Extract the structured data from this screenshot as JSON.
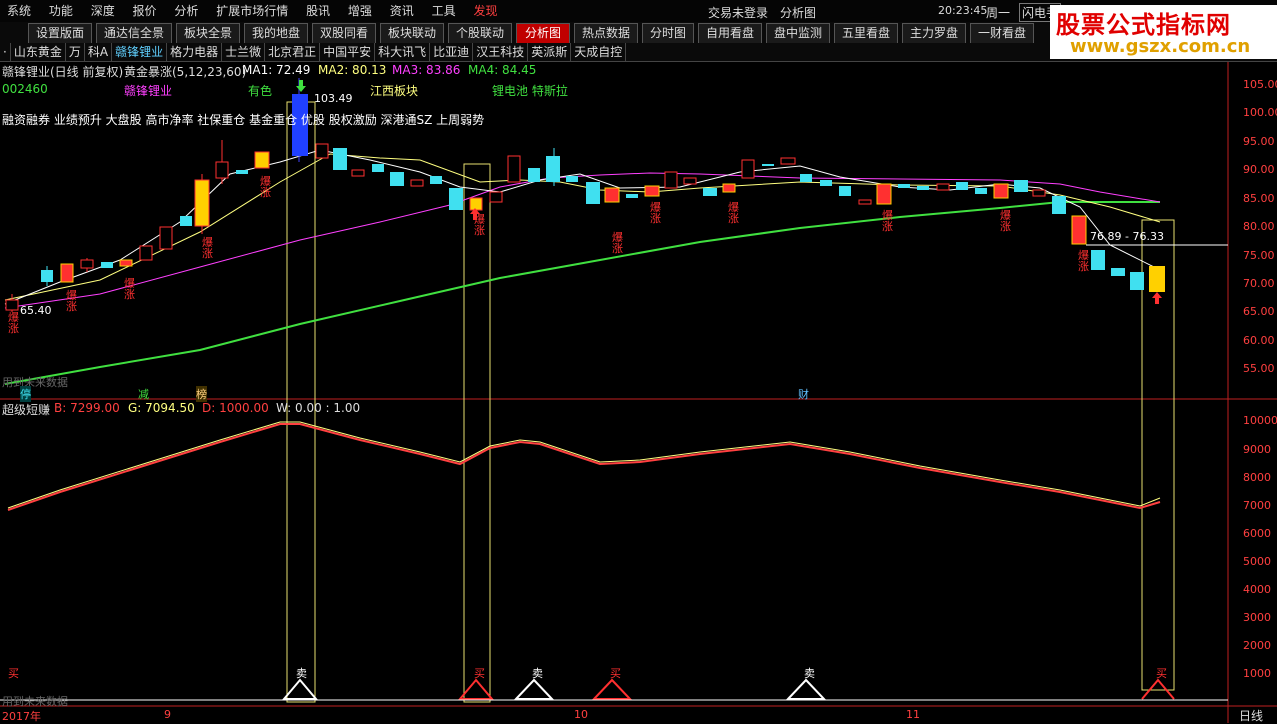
{
  "menubar": {
    "items": [
      "系统",
      "功能",
      "深度",
      "报价",
      "分析",
      "扩展市场行情",
      "股讯",
      "增强",
      "资讯",
      "工具",
      "发现"
    ],
    "status": "交易未登录",
    "module": "分析图",
    "clock": "20:23:45",
    "weekday": "周一",
    "flash_btn": "闪电手"
  },
  "tabs": [
    "设置版面",
    "通达信全景",
    "板块全景",
    "我的地盘",
    "双股同看",
    "板块联动",
    "个股联动",
    "分析图",
    "热点数据",
    "分时图",
    "自用看盘",
    "盘中监测",
    "五里看盘",
    "主力罗盘",
    "一财看盘"
  ],
  "stocks": [
    "·",
    "山东黄金",
    "万",
    "科A",
    "赣锋锂业",
    "格力电器",
    "士兰微",
    "北京君正",
    "中国平安",
    "科大讯飞",
    "比亚迪",
    "汉王科技",
    "英派斯",
    "天成自控"
  ],
  "logo": {
    "line1": "股票公式指标网",
    "line2": "www.gszx.com.cn"
  },
  "info": {
    "name": "赣锋锂业(日线 前复权)",
    "indicator": "黄金暴涨(5,12,23,60)",
    "ma1": "MA1: 72.49",
    "ma2": "MA2: 80.13",
    "ma3": "MA3: 83.86",
    "ma4": "MA4: 84.45",
    "code": "002460",
    "name2": "赣锋锂业",
    "sector1": "有色",
    "sector2": "江西板块",
    "sector3": "锂电池 特斯拉",
    "concepts": "融资融券 业绩预升 大盘股 高市净率 社保重仓 基金重仓 优股 股权激励 深港通SZ 上周弱势",
    "high": "103.49",
    "low": "65.40",
    "range": "76.89 - 76.33",
    "nodata": "用到未来数据"
  },
  "sub": {
    "title": "超级短赚",
    "b": "B: 7299.00",
    "g": "G: 7094.50",
    "d": "D: 1000.00",
    "w": "W: 0.00 : 1.00"
  },
  "markers": {
    "ting": "停",
    "jian": "减",
    "bang": "榜",
    "cai": "财",
    "buy": "买",
    "sell": "卖",
    "boom": "爆涨"
  },
  "xaxis": {
    "year": "2017年",
    "m9": "9",
    "m10": "10",
    "m11": "11",
    "period": "日线"
  },
  "yaxis_main": [
    "105.00",
    "100.00",
    "95.00",
    "90.00",
    "85.00",
    "80.00",
    "75.00",
    "70.00",
    "65.00",
    "60.00",
    "55.00"
  ],
  "yaxis_sub": [
    "10000",
    "9000",
    "8000",
    "7000",
    "6000",
    "5000",
    "4000",
    "3000",
    "2000",
    "1000"
  ],
  "colors": {
    "up": "#ff3030",
    "down": "#40e0f0",
    "ma1": "#ffffff",
    "ma2": "#ffff80",
    "ma3": "#ff40ff",
    "ma4": "#40e040"
  }
}
